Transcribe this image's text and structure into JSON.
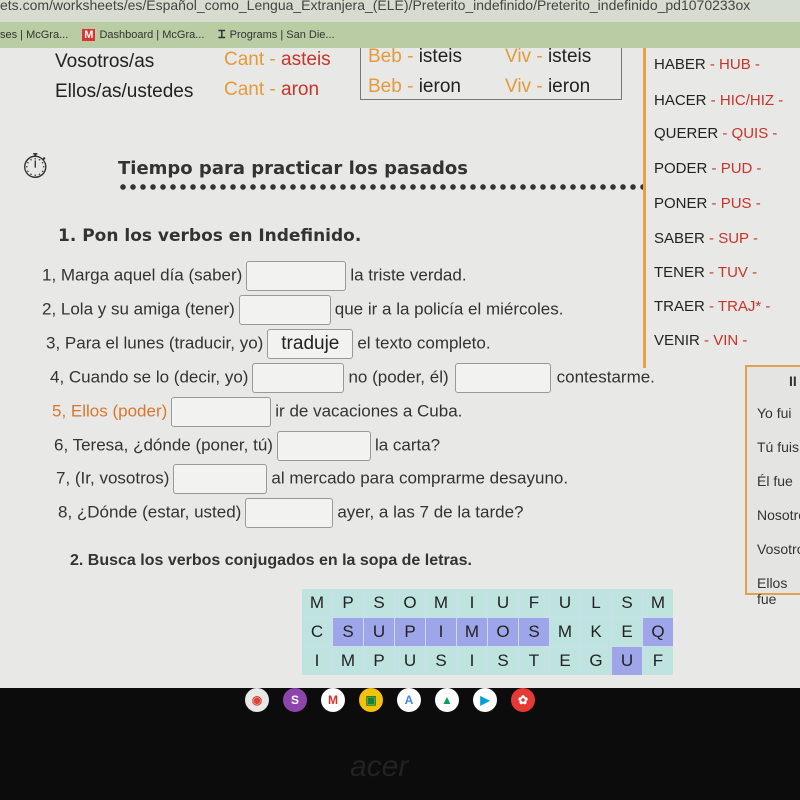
{
  "browser": {
    "url": "ets.com/worksheets/es/Español_como_Lengua_Extranjera_(ELE)/Preterito_indefinido/Preterito_indefinido_pd1070233ox",
    "bookmarks": [
      {
        "icon": "bookmark-icon",
        "label": "ses | McGra..."
      },
      {
        "icon": "mcgraw-m-icon",
        "label": "Dashboard | McGra..."
      },
      {
        "icon": "san-diego-icon",
        "label": "Programs | San Die..."
      }
    ]
  },
  "conjugation": [
    {
      "pronoun": "Vosotros/as",
      "ar_stem": "Cant",
      "ar_end": "asteis",
      "er_stem": "Beb",
      "er_end": "isteis",
      "ir_stem": "Viv",
      "ir_end": "isteis"
    },
    {
      "pronoun": "Ellos/as/ustedes",
      "ar_stem": "Cant",
      "ar_end": "aron",
      "er_stem": "Beb",
      "er_end": "ieron",
      "ir_stem": "Viv",
      "ir_end": "ieron"
    }
  ],
  "irregulars": [
    {
      "verb": "HABER",
      "stem": "HUB -"
    },
    {
      "verb": "HACER",
      "stem": "HIC/HIZ -"
    },
    {
      "verb": "QUERER",
      "stem": "QUIS -"
    },
    {
      "verb": "PODER",
      "stem": "PUD -"
    },
    {
      "verb": "PONER",
      "stem": "PUS -"
    },
    {
      "verb": "SABER",
      "stem": "SUP -"
    },
    {
      "verb": "TENER",
      "stem": "TUV -"
    },
    {
      "verb": "TRAER",
      "stem": "TRAJ* -"
    },
    {
      "verb": "VENIR",
      "stem": "VIN -"
    }
  ],
  "section_title": "Tiempo para practicar los pasados",
  "exercise1": {
    "title": "1. Pon los verbos en Indefinido.",
    "items": [
      {
        "before": "1, Marga aquel día (saber)",
        "value": "",
        "after": "la triste verdad."
      },
      {
        "before": "2, Lola y su amiga (tener)",
        "value": "",
        "after": "que ir a la policía el miércoles."
      },
      {
        "before": "3, Para el lunes (traducir, yo)",
        "value": "traduje",
        "after": "el texto completo."
      },
      {
        "before": "4, Cuando se lo (decir, yo)",
        "value": "",
        "after": "no (poder, él)",
        "value2": "",
        "after2": "contestarme."
      },
      {
        "before": "5, Ellos (poder)",
        "value": "",
        "after": "ir de vacaciones a Cuba."
      },
      {
        "before": "6, Teresa, ¿dónde (poner, tú)",
        "value": "",
        "after": "la carta?"
      },
      {
        "before": "7, (Ir, vosotros)",
        "value": "",
        "after": "al mercado para comprarme desayuno."
      },
      {
        "before": "8, ¿Dónde (estar, usted)",
        "value": "",
        "after": "ayer, a las 7 de la tarde?"
      }
    ]
  },
  "ser_ir_table": {
    "header": "II",
    "rows": [
      "Yo fui",
      "Tú fuis",
      "Él fue",
      "Nosotro",
      "Vosotro",
      "Ellos fue"
    ]
  },
  "exercise2": {
    "title": "2. Busca los verbos conjugados en la sopa de letras.",
    "grid": [
      [
        "M",
        "P",
        "S",
        "O",
        "M",
        "I",
        "U",
        "F",
        "U",
        "L",
        "S",
        "M"
      ],
      [
        "C",
        "S",
        "U",
        "P",
        "I",
        "M",
        "O",
        "S",
        "M",
        "K",
        "E",
        "Q"
      ],
      [
        "I",
        "M",
        "P",
        "U",
        "S",
        "I",
        "S",
        "T",
        "E",
        "G",
        "U",
        "F"
      ]
    ],
    "highlighted": [
      [
        1,
        1
      ],
      [
        1,
        2
      ],
      [
        1,
        3
      ],
      [
        1,
        4
      ],
      [
        1,
        5
      ],
      [
        1,
        6
      ],
      [
        1,
        7
      ],
      [
        1,
        11
      ],
      [
        2,
        10
      ]
    ]
  },
  "colors": {
    "stem": "#e39a3a",
    "ending": "#c7342a",
    "cell": "#bfe3df",
    "highlight": "#9ea5e8"
  },
  "shelf": [
    "chrome-icon",
    "sound-icon",
    "gmail-icon",
    "classroom-icon",
    "docs-icon",
    "drive-icon",
    "play-store-icon",
    "paint-icon"
  ],
  "laptop_brand": "acer"
}
